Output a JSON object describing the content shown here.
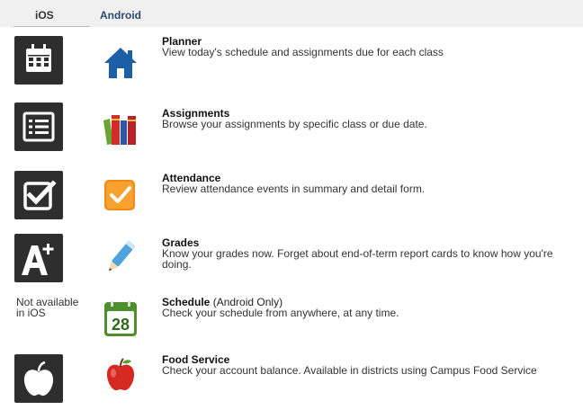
{
  "tabs": {
    "ios": "iOS",
    "android": "Android"
  },
  "features": [
    {
      "icon_ios": "calendar-grid-icon",
      "icon_android": "house-icon",
      "title": "Planner",
      "desc": "View today's schedule and assignments due for each class"
    },
    {
      "icon_ios": "list-icon",
      "icon_android": "books-icon",
      "title": "Assignments",
      "desc": "Browse your assignments by specific class or due date."
    },
    {
      "icon_ios": "checkbox-icon",
      "icon_android": "orange-check-icon",
      "title": "Attendance",
      "desc": "Review attendance events in summary and detail form."
    },
    {
      "icon_ios": "a-plus-icon",
      "icon_android": "pencil-icon",
      "title": "Grades",
      "desc": "Know your grades now. Forget about end-of-term report cards to know how you're doing."
    },
    {
      "ios_unavailable": "Not available in iOS",
      "icon_android": "calendar-28-icon",
      "calendar_day": "28",
      "title": "Schedule",
      "note": "(Android Only)",
      "desc": "Check your schedule from anywhere, at any time."
    },
    {
      "icon_ios": "apple-icon",
      "icon_android": "red-apple-icon",
      "title": "Food Service",
      "desc": "Check your account balance. Available in districts using Campus Food Service"
    }
  ]
}
